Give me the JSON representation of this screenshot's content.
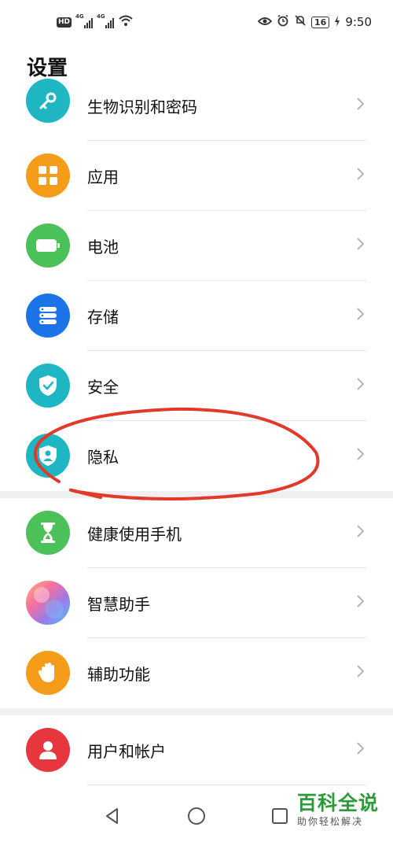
{
  "status_bar": {
    "left": {
      "hd": "HD",
      "signal1_tag": "4G",
      "signal2_tag": "4G"
    },
    "right": {
      "battery": "16",
      "time": "9:50"
    }
  },
  "page_title": "设置",
  "settings_items": [
    {
      "label": "生物识别和密码",
      "icon": "key-icon",
      "color": "#1fb6c4"
    },
    {
      "label": "应用",
      "icon": "apps-grid-icon",
      "color": "#f59c1a"
    },
    {
      "label": "电池",
      "icon": "battery-icon",
      "color": "#4cc15a"
    },
    {
      "label": "存储",
      "icon": "storage-icon",
      "color": "#1c73e8"
    },
    {
      "label": "安全",
      "icon": "shield-check-icon",
      "color": "#1fb6c4"
    },
    {
      "label": "隐私",
      "icon": "privacy-shield-icon",
      "color": "#1fb6c4"
    },
    {
      "label": "健康使用手机",
      "icon": "hourglass-icon",
      "color": "#4cc15a"
    },
    {
      "label": "智慧助手",
      "icon": "assistant-orb-icon",
      "color": "#9b7be6"
    },
    {
      "label": "辅助功能",
      "icon": "hand-icon",
      "color": "#f59c1a"
    },
    {
      "label": "用户和帐户",
      "icon": "user-icon",
      "color": "#e8363f"
    }
  ],
  "nav_bar": {
    "back": "back-triangle-icon",
    "home": "home-circle-icon",
    "recents": "recents-square-icon"
  },
  "watermark": {
    "title": "百科全说",
    "subtitle": "助你轻松解决"
  }
}
